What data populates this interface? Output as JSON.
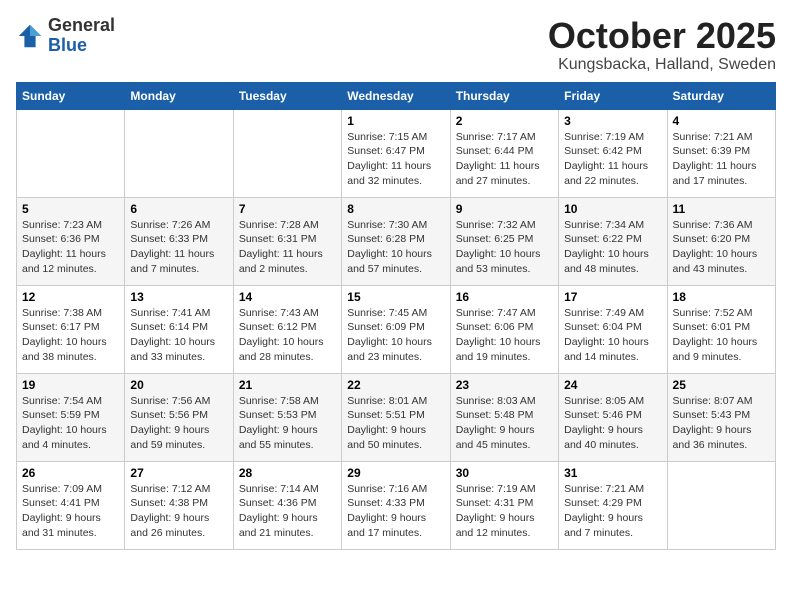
{
  "logo": {
    "general": "General",
    "blue": "Blue"
  },
  "header": {
    "month": "October 2025",
    "location": "Kungsbacka, Halland, Sweden"
  },
  "weekdays": [
    "Sunday",
    "Monday",
    "Tuesday",
    "Wednesday",
    "Thursday",
    "Friday",
    "Saturday"
  ],
  "weeks": [
    [
      {
        "day": "",
        "info": ""
      },
      {
        "day": "",
        "info": ""
      },
      {
        "day": "",
        "info": ""
      },
      {
        "day": "1",
        "info": "Sunrise: 7:15 AM\nSunset: 6:47 PM\nDaylight: 11 hours\nand 32 minutes."
      },
      {
        "day": "2",
        "info": "Sunrise: 7:17 AM\nSunset: 6:44 PM\nDaylight: 11 hours\nand 27 minutes."
      },
      {
        "day": "3",
        "info": "Sunrise: 7:19 AM\nSunset: 6:42 PM\nDaylight: 11 hours\nand 22 minutes."
      },
      {
        "day": "4",
        "info": "Sunrise: 7:21 AM\nSunset: 6:39 PM\nDaylight: 11 hours\nand 17 minutes."
      }
    ],
    [
      {
        "day": "5",
        "info": "Sunrise: 7:23 AM\nSunset: 6:36 PM\nDaylight: 11 hours\nand 12 minutes."
      },
      {
        "day": "6",
        "info": "Sunrise: 7:26 AM\nSunset: 6:33 PM\nDaylight: 11 hours\nand 7 minutes."
      },
      {
        "day": "7",
        "info": "Sunrise: 7:28 AM\nSunset: 6:31 PM\nDaylight: 11 hours\nand 2 minutes."
      },
      {
        "day": "8",
        "info": "Sunrise: 7:30 AM\nSunset: 6:28 PM\nDaylight: 10 hours\nand 57 minutes."
      },
      {
        "day": "9",
        "info": "Sunrise: 7:32 AM\nSunset: 6:25 PM\nDaylight: 10 hours\nand 53 minutes."
      },
      {
        "day": "10",
        "info": "Sunrise: 7:34 AM\nSunset: 6:22 PM\nDaylight: 10 hours\nand 48 minutes."
      },
      {
        "day": "11",
        "info": "Sunrise: 7:36 AM\nSunset: 6:20 PM\nDaylight: 10 hours\nand 43 minutes."
      }
    ],
    [
      {
        "day": "12",
        "info": "Sunrise: 7:38 AM\nSunset: 6:17 PM\nDaylight: 10 hours\nand 38 minutes."
      },
      {
        "day": "13",
        "info": "Sunrise: 7:41 AM\nSunset: 6:14 PM\nDaylight: 10 hours\nand 33 minutes."
      },
      {
        "day": "14",
        "info": "Sunrise: 7:43 AM\nSunset: 6:12 PM\nDaylight: 10 hours\nand 28 minutes."
      },
      {
        "day": "15",
        "info": "Sunrise: 7:45 AM\nSunset: 6:09 PM\nDaylight: 10 hours\nand 23 minutes."
      },
      {
        "day": "16",
        "info": "Sunrise: 7:47 AM\nSunset: 6:06 PM\nDaylight: 10 hours\nand 19 minutes."
      },
      {
        "day": "17",
        "info": "Sunrise: 7:49 AM\nSunset: 6:04 PM\nDaylight: 10 hours\nand 14 minutes."
      },
      {
        "day": "18",
        "info": "Sunrise: 7:52 AM\nSunset: 6:01 PM\nDaylight: 10 hours\nand 9 minutes."
      }
    ],
    [
      {
        "day": "19",
        "info": "Sunrise: 7:54 AM\nSunset: 5:59 PM\nDaylight: 10 hours\nand 4 minutes."
      },
      {
        "day": "20",
        "info": "Sunrise: 7:56 AM\nSunset: 5:56 PM\nDaylight: 9 hours\nand 59 minutes."
      },
      {
        "day": "21",
        "info": "Sunrise: 7:58 AM\nSunset: 5:53 PM\nDaylight: 9 hours\nand 55 minutes."
      },
      {
        "day": "22",
        "info": "Sunrise: 8:01 AM\nSunset: 5:51 PM\nDaylight: 9 hours\nand 50 minutes."
      },
      {
        "day": "23",
        "info": "Sunrise: 8:03 AM\nSunset: 5:48 PM\nDaylight: 9 hours\nand 45 minutes."
      },
      {
        "day": "24",
        "info": "Sunrise: 8:05 AM\nSunset: 5:46 PM\nDaylight: 9 hours\nand 40 minutes."
      },
      {
        "day": "25",
        "info": "Sunrise: 8:07 AM\nSunset: 5:43 PM\nDaylight: 9 hours\nand 36 minutes."
      }
    ],
    [
      {
        "day": "26",
        "info": "Sunrise: 7:09 AM\nSunset: 4:41 PM\nDaylight: 9 hours\nand 31 minutes."
      },
      {
        "day": "27",
        "info": "Sunrise: 7:12 AM\nSunset: 4:38 PM\nDaylight: 9 hours\nand 26 minutes."
      },
      {
        "day": "28",
        "info": "Sunrise: 7:14 AM\nSunset: 4:36 PM\nDaylight: 9 hours\nand 21 minutes."
      },
      {
        "day": "29",
        "info": "Sunrise: 7:16 AM\nSunset: 4:33 PM\nDaylight: 9 hours\nand 17 minutes."
      },
      {
        "day": "30",
        "info": "Sunrise: 7:19 AM\nSunset: 4:31 PM\nDaylight: 9 hours\nand 12 minutes."
      },
      {
        "day": "31",
        "info": "Sunrise: 7:21 AM\nSunset: 4:29 PM\nDaylight: 9 hours\nand 7 minutes."
      },
      {
        "day": "",
        "info": ""
      }
    ]
  ]
}
